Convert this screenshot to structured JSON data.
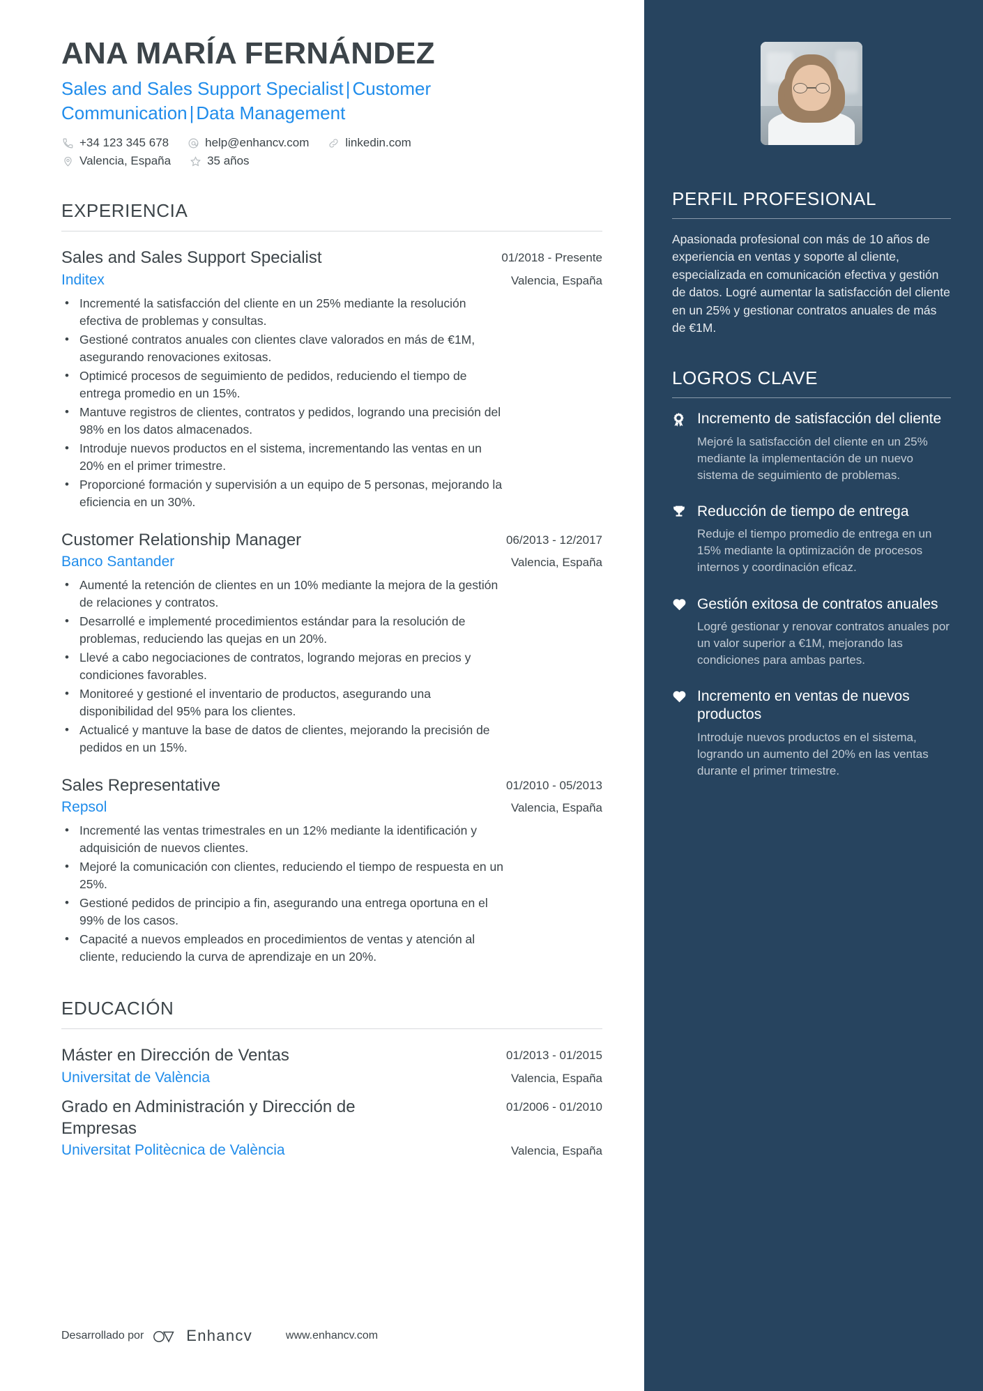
{
  "header": {
    "name": "ANA MARÍA FERNÁNDEZ",
    "headline_part1": "Sales and Sales Support Specialist",
    "headline_part2": "Customer Communication",
    "headline_part3": "Data Management",
    "headline_separator": "|",
    "contacts": [
      {
        "icon": "phone-icon",
        "value": "+34 123 345 678"
      },
      {
        "icon": "email-icon",
        "value": "help@enhancv.com"
      },
      {
        "icon": "link-icon",
        "value": "linkedin.com"
      },
      {
        "icon": "location-pin-icon",
        "value": "Valencia, España"
      },
      {
        "icon": "star-icon",
        "value": "35 años"
      }
    ],
    "photo_alt": "portrait-photo"
  },
  "experience": {
    "title": "EXPERIENCIA",
    "items": [
      {
        "role": "Sales and Sales Support Specialist",
        "dates": "01/2018 - Presente",
        "company": "Inditex",
        "location": "Valencia, España",
        "bullets": [
          "Incrementé la satisfacción del cliente en un 25% mediante la resolución efectiva de problemas y consultas.",
          "Gestioné contratos anuales con clientes clave valorados en más de €1M, asegurando renovaciones exitosas.",
          "Optimicé procesos de seguimiento de pedidos, reduciendo el tiempo de entrega promedio en un 15%.",
          "Mantuve registros de clientes, contratos y pedidos, logrando una precisión del 98% en los datos almacenados.",
          "Introduje nuevos productos en el sistema, incrementando las ventas en un 20% en el primer trimestre.",
          "Proporcioné formación y supervisión a un equipo de 5 personas, mejorando la eficiencia en un 30%."
        ]
      },
      {
        "role": "Customer Relationship Manager",
        "dates": "06/2013 - 12/2017",
        "company": "Banco Santander",
        "location": "Valencia, España",
        "bullets": [
          "Aumenté la retención de clientes en un 10% mediante la mejora de la gestión de relaciones y contratos.",
          "Desarrollé e implementé procedimientos estándar para la resolución de problemas, reduciendo las quejas en un 20%.",
          "Llevé a cabo negociaciones de contratos, logrando mejoras en precios y condiciones favorables.",
          "Monitoreé y gestioné el inventario de productos, asegurando una disponibilidad del 95% para los clientes.",
          "Actualicé y mantuve la base de datos de clientes, mejorando la precisión de pedidos en un 15%."
        ]
      },
      {
        "role": "Sales Representative",
        "dates": "01/2010 - 05/2013",
        "company": "Repsol",
        "location": "Valencia, España",
        "bullets": [
          "Incrementé las ventas trimestrales en un 12% mediante la identificación y adquisición de nuevos clientes.",
          "Mejoré la comunicación con clientes, reduciendo el tiempo de respuesta en un 25%.",
          "Gestioné pedidos de principio a fin, asegurando una entrega oportuna en el 99% de los casos.",
          "Capacité a nuevos empleados en procedimientos de ventas y atención al cliente, reduciendo la curva de aprendizaje en un 20%."
        ]
      }
    ]
  },
  "education": {
    "title": "EDUCACIÓN",
    "items": [
      {
        "degree": "Máster en Dirección de Ventas",
        "dates": "01/2013 - 01/2015",
        "school": "Universitat de València",
        "location": "Valencia, España"
      },
      {
        "degree": "Grado en Administración y Dirección de Empresas",
        "dates": "01/2006 - 01/2010",
        "school": "Universitat Politècnica de València",
        "location": "Valencia, España"
      }
    ]
  },
  "profile": {
    "title": "PERFIL PROFESIONAL",
    "text": "Apasionada profesional con más de 10 años de experiencia en ventas y soporte al cliente, especializada en comunicación efectiva y gestión de datos. Logré aumentar la satisfacción del cliente en un 25% y gestionar contratos anuales de más de €1M."
  },
  "achievements": {
    "title": "LOGROS CLAVE",
    "items": [
      {
        "icon": "award-ribbon-icon",
        "title": "Incremento de satisfacción del cliente",
        "description": "Mejoré la satisfacción del cliente en un 25% mediante la implementación de un nuevo sistema de seguimiento de problemas."
      },
      {
        "icon": "trophy-icon",
        "title": "Reducción de tiempo de entrega",
        "description": "Reduje el tiempo promedio de entrega en un 15% mediante la optimización de procesos internos y coordinación eficaz."
      },
      {
        "icon": "heart-icon",
        "title": "Gestión exitosa de contratos anuales",
        "description": "Logré gestionar y renovar contratos anuales por un valor superior a €1M, mejorando las condiciones para ambas partes."
      },
      {
        "icon": "heart-icon",
        "title": "Incremento en ventas de nuevos productos",
        "description": "Introduje nuevos productos en el sistema, logrando un aumento del 20% en las ventas durante el primer trimestre."
      }
    ]
  },
  "footer": {
    "powered_by": "Desarrollado por",
    "brand": "Enhancv",
    "website": "www.enhancv.com"
  },
  "colors": {
    "accent_blue": "#1f8ceb",
    "sidebar_navy": "#27445f",
    "text_dark": "#3c4449"
  }
}
